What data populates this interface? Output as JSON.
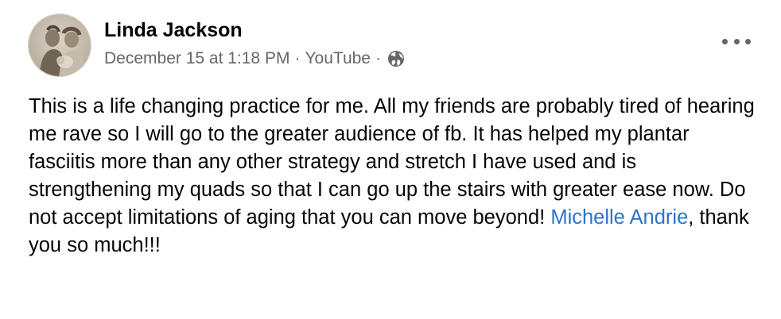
{
  "post": {
    "author": "Linda Jackson",
    "timestamp": "December 15 at 1:18 PM",
    "separator": "·",
    "source": "YouTube",
    "privacy_icon": "globe-icon",
    "more_icon": "more-options-icon",
    "body_before_mention": "This is a life changing practice for me. All my friends are probably tired of hearing me rave so I will go to the greater audience of fb. It has helped my plantar fasciitis more than any other strategy and stretch I have used and is strengthening my quads so that I can go up the stairs with greater ease now. Do not accept limitations of aging that you can move beyond! ",
    "mention": "Michelle Andrie",
    "body_after_mention": ", thank you so much!!!"
  },
  "colors": {
    "name": "#050505",
    "secondary_text": "#65676b",
    "link": "#2d73c9",
    "background": "#ffffff"
  }
}
